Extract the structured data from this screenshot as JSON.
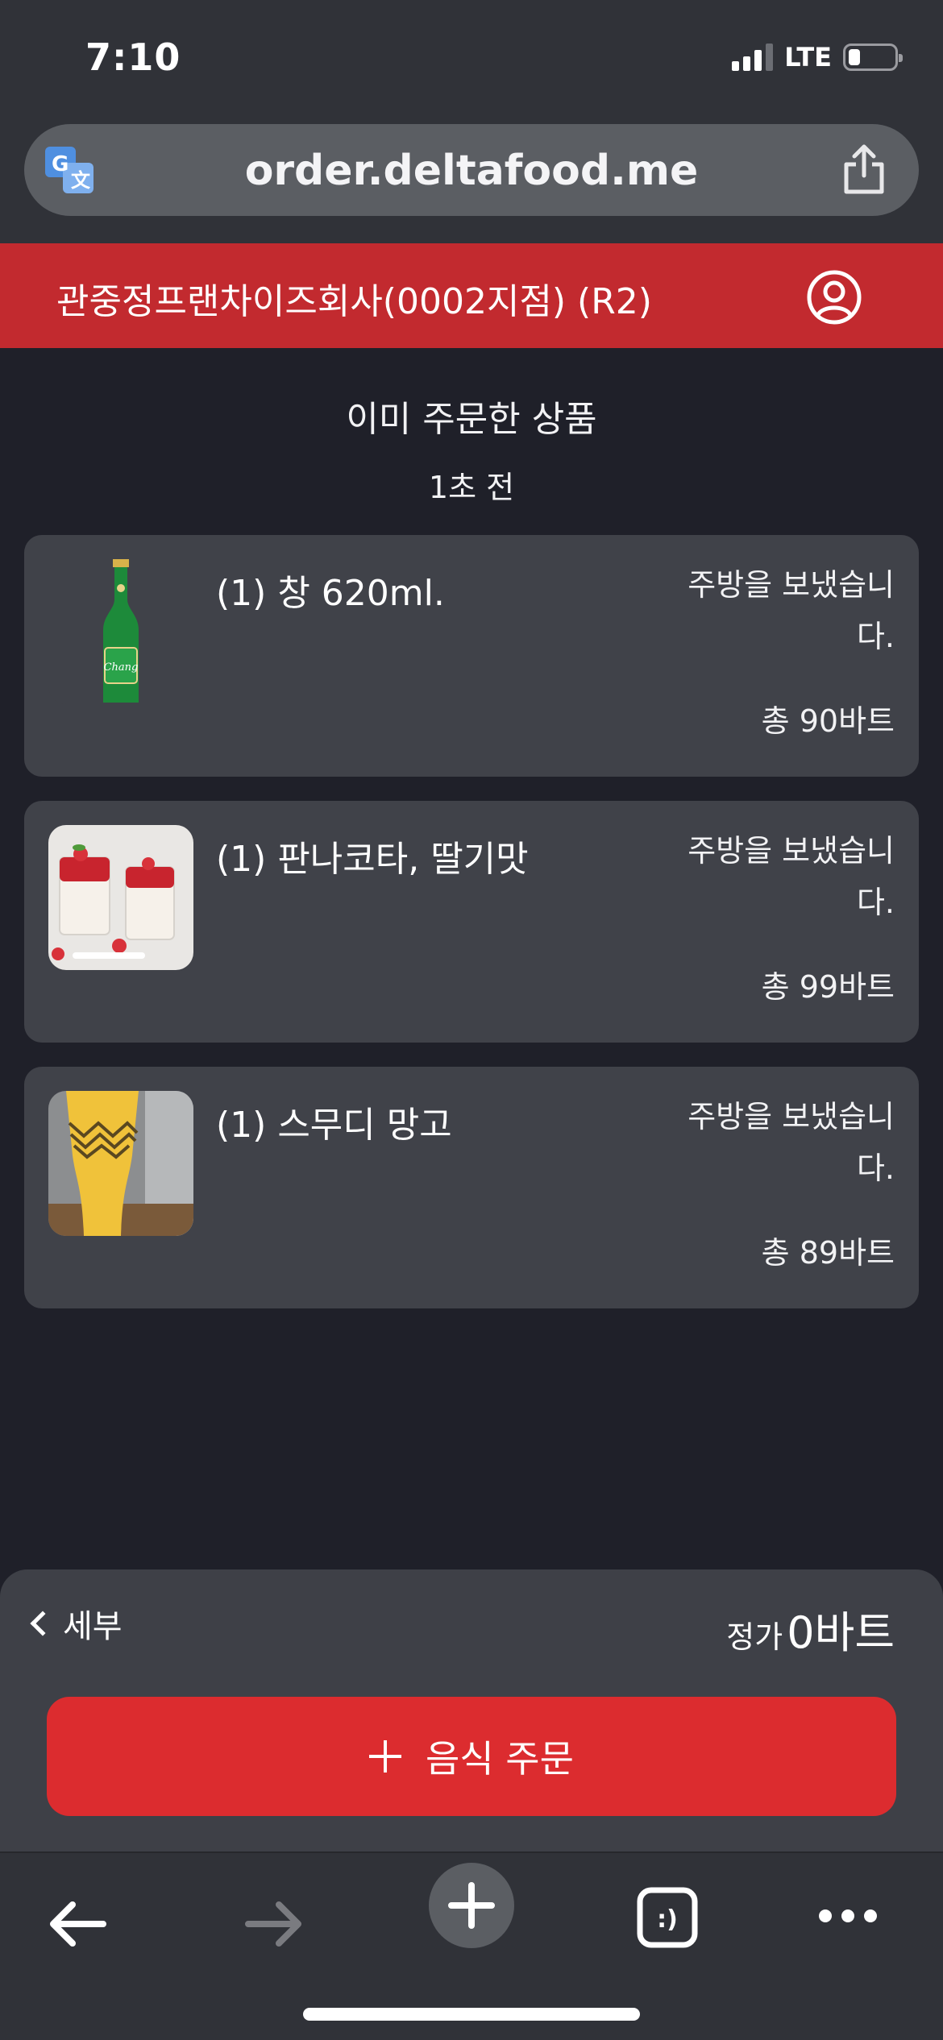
{
  "status_bar": {
    "time": "7:10",
    "network": "LTE"
  },
  "browser": {
    "url": "order.deltafood.me"
  },
  "header": {
    "store_name": "관중정프랜차이즈회사(0002지점) (R2)"
  },
  "orders_section": {
    "title": "이미 주문한 상품",
    "time_ago": "1초 전"
  },
  "orders": [
    {
      "name": "(1) 창 620ml.",
      "status_line1": "주방을 보냈습니",
      "status_line2": "다.",
      "total": "총 90바트",
      "image_icon": "chang-beer-bottle"
    },
    {
      "name": "(1) 판나코타, 딸기맛",
      "status_line1": "주방을 보냈습니",
      "status_line2": "다.",
      "total": "총 99바트",
      "image_icon": "strawberry-panna-cotta"
    },
    {
      "name": "(1) 스무디 망고",
      "status_line1": "주방을 보냈습니",
      "status_line2": "다.",
      "total": "총 89바트",
      "image_icon": "mango-smoothie"
    }
  ],
  "bottom_bar": {
    "details_label": "세부",
    "price_label": "정가",
    "price_value": "0바트",
    "order_button_label": "음식 주문"
  },
  "colors": {
    "accent_red": "#dc2c2f",
    "header_red": "#c22a2f",
    "background": "#1f2029",
    "card": "#404249"
  }
}
